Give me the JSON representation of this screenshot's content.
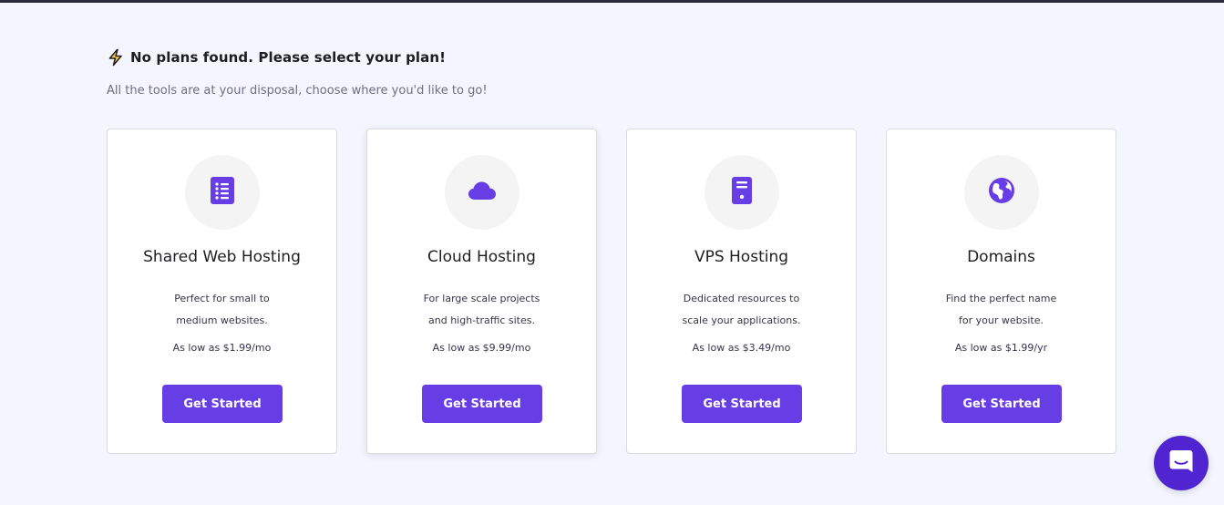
{
  "heading": {
    "text": "No plans found. Please select your plan!",
    "icon": "lightning-bolt-icon"
  },
  "subheading": "All the tools are at your disposal, choose where you'd like to go!",
  "accent_color": "#673de6",
  "cards": [
    {
      "icon": "document-list-icon",
      "title": "Shared Web Hosting",
      "desc_line1": "Perfect for small to",
      "desc_line2": "medium websites.",
      "price": "As low as $1.99/mo",
      "button": "Get Started"
    },
    {
      "icon": "cloud-icon",
      "title": "Cloud Hosting",
      "desc_line1": "For large scale projects",
      "desc_line2": "and high-traffic sites.",
      "price": "As low as $9.99/mo",
      "button": "Get Started"
    },
    {
      "icon": "server-icon",
      "title": "VPS Hosting",
      "desc_line1": "Dedicated resources to",
      "desc_line2": "scale your applications.",
      "price": "As low as $3.49/mo",
      "button": "Get Started"
    },
    {
      "icon": "globe-icon",
      "title": "Domains",
      "desc_line1": "Find the perfect name",
      "desc_line2": "for your website.",
      "price": "As low as $1.99/yr",
      "button": "Get Started"
    }
  ],
  "chat": {
    "icon": "chat-bubble-icon"
  }
}
